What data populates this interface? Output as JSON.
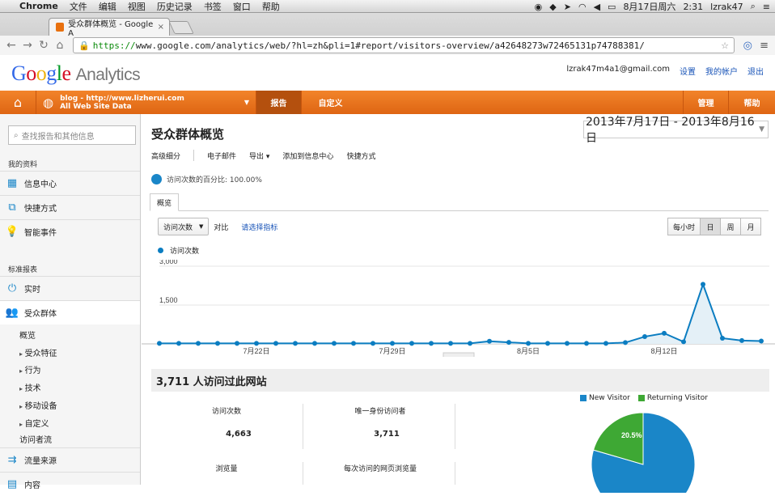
{
  "macbar": {
    "apple": "",
    "app": "Chrome",
    "menus": [
      "文件",
      "编辑",
      "视图",
      "历史记录",
      "书签",
      "窗口",
      "帮助"
    ],
    "datetime": "8月17日周六",
    "time": "2:31",
    "user": "lzrak47"
  },
  "browser": {
    "tab_title": "受众群体概览 - Google A",
    "url_scheme": "https://",
    "url_rest": "www.google.com/analytics/web/?hl=zh&pli=1#report/visitors-overview/a42648273w72465131p74788381/"
  },
  "header": {
    "logo_google": "Google",
    "logo_product": "Analytics",
    "email": "lzrak47m4a1@gmail.com",
    "settings": "设置",
    "my_account": "我的帐户",
    "logout": "退出"
  },
  "orangebar": {
    "property_line1": "blog - http://www.lizherui.com",
    "property_line2": "All Web Site Data",
    "nav_reports": "报告",
    "nav_custom": "自定义",
    "nav_admin": "管理",
    "nav_help": "帮助"
  },
  "sidebar": {
    "search_placeholder": "查找报告和其他信息",
    "section_my": "我的资料",
    "dashboards": "信息中心",
    "shortcuts": "快捷方式",
    "intel": "智能事件",
    "section_std": "标准报表",
    "realtime": "实时",
    "audience": "受众群体",
    "sub_overview": "概览",
    "sub_demographics": "受众特征",
    "sub_behavior": "行为",
    "sub_technology": "技术",
    "sub_mobile": "移动设备",
    "sub_custom": "自定义",
    "visitors_flow": "访问者流",
    "traffic_sources": "流量来源",
    "cut_item": "内容"
  },
  "main": {
    "title": "受众群体概览",
    "date_range": "2013年7月17日 - 2013年8月16日",
    "toolbar": [
      "高级细分",
      "电子邮件",
      "导出 ▾",
      "添加到信息中心",
      "快捷方式"
    ],
    "segment_text": "访问次数的百分比: 100.00%",
    "tab_overview": "概览",
    "metric_dropdown": "访问次数",
    "compare": "对比",
    "choose_metric": "请选择指标",
    "gran_hour": "每小时",
    "gran_day": "日",
    "gran_week": "周",
    "gran_month": "月",
    "legend_metric": "访问次数",
    "summary_title": "3,711 人访问过此网站",
    "stat_visits_label": "访问次数",
    "stat_visits_value": "4,663",
    "stat_unique_label": "唯一身份访问者",
    "stat_unique_value": "3,711",
    "stat_pageviews_label": "浏览量",
    "stat_ppv_label": "每次访问的网页浏览量"
  },
  "chart_data": {
    "type": "area",
    "series": [
      {
        "name": "访问次数",
        "values": [
          20,
          20,
          20,
          20,
          20,
          20,
          20,
          20,
          20,
          20,
          20,
          20,
          20,
          20,
          20,
          20,
          20,
          100,
          60,
          20,
          20,
          20,
          20,
          20,
          50,
          280,
          410,
          80,
          2300,
          220,
          130,
          110
        ]
      }
    ],
    "x_tick_labels": [
      "7月22日",
      "7月29日",
      "8月5日",
      "8月12日"
    ],
    "y_tick_labels": [
      "3,000",
      "1,500"
    ],
    "ylim": [
      0,
      3000
    ],
    "color": "#0b7dc1"
  },
  "pie": {
    "legend": [
      {
        "label": "New Visitor",
        "color": "#1a86c8"
      },
      {
        "label": "Returning Visitor",
        "color": "#3ea834"
      }
    ],
    "values": [
      79.5,
      20.5
    ],
    "label_returning": "20.5%"
  }
}
